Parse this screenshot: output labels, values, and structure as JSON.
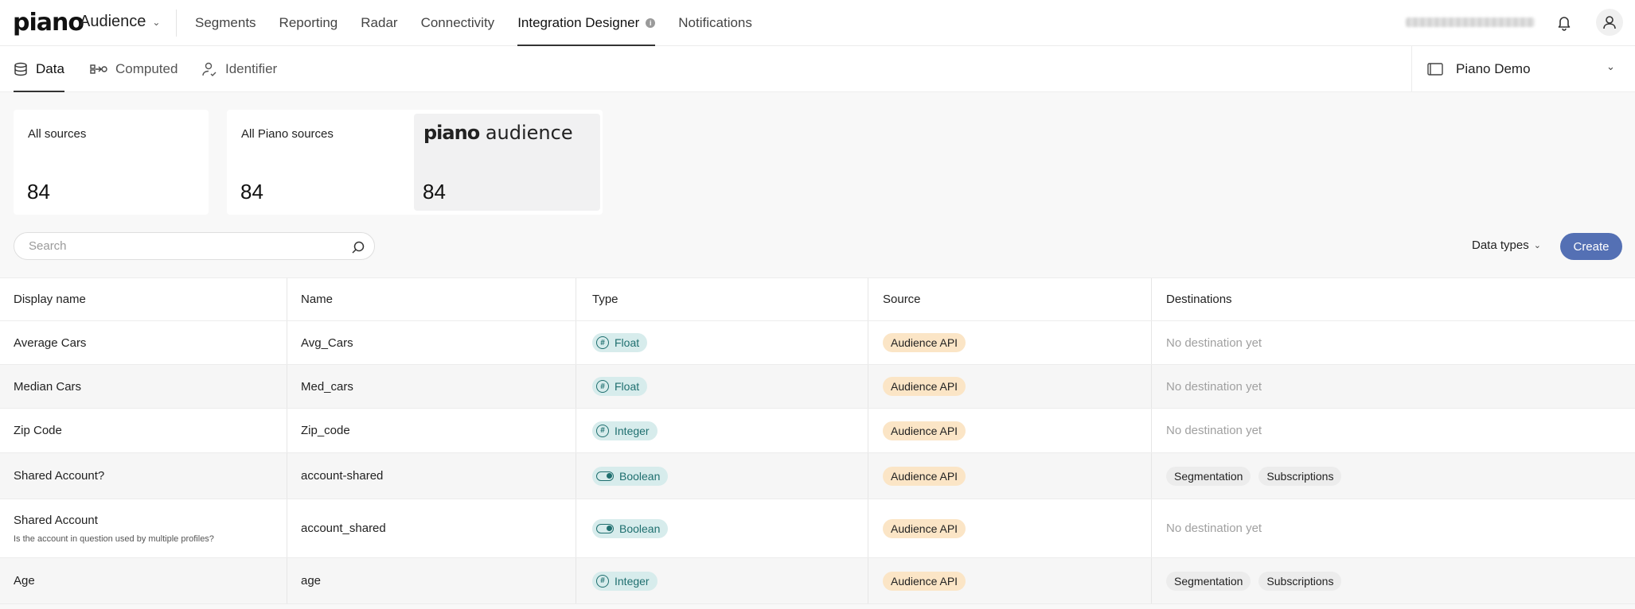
{
  "header": {
    "logo": "piano",
    "app_name": "Audience",
    "nav": [
      {
        "label": "Segments",
        "active": false
      },
      {
        "label": "Reporting",
        "active": false
      },
      {
        "label": "Radar",
        "active": false
      },
      {
        "label": "Connectivity",
        "active": false
      },
      {
        "label": "Integration Designer",
        "active": true
      },
      {
        "label": "Notifications",
        "active": false
      }
    ],
    "info_icon": "info-icon",
    "bell_icon": "bell-icon",
    "user_icon": "user-icon"
  },
  "subnav": {
    "tabs": [
      {
        "label": "Data",
        "icon": "database-icon",
        "active": true
      },
      {
        "label": "Computed",
        "icon": "computed-icon",
        "active": false
      },
      {
        "label": "Identifier",
        "icon": "identifier-icon",
        "active": false
      }
    ],
    "workspace": {
      "label": "Piano Demo",
      "icon": "workspace-icon"
    }
  },
  "cards": [
    {
      "label": "All sources",
      "value": "84"
    },
    {
      "label": "All Piano sources",
      "value": "84"
    },
    {
      "brand_bold": "piano",
      "brand_light": "audience",
      "value": "84",
      "selected": true
    }
  ],
  "toolbar": {
    "search_placeholder": "Search",
    "data_types_label": "Data types",
    "create_label": "Create"
  },
  "table": {
    "columns": [
      "Display name",
      "Name",
      "Type",
      "Source",
      "Destinations"
    ],
    "rows": [
      {
        "display_name": "Average Cars",
        "description": "",
        "name": "Avg_Cars",
        "type": "Float",
        "type_icon": "hash-icon",
        "source": "Audience API",
        "destinations": [],
        "no_destination": "No destination yet"
      },
      {
        "display_name": "Median Cars",
        "description": "",
        "name": "Med_cars",
        "type": "Float",
        "type_icon": "hash-icon",
        "source": "Audience API",
        "destinations": [],
        "no_destination": "No destination yet"
      },
      {
        "display_name": "Zip Code",
        "description": "",
        "name": "Zip_code",
        "type": "Integer",
        "type_icon": "hash-icon",
        "source": "Audience API",
        "destinations": [],
        "no_destination": "No destination yet"
      },
      {
        "display_name": "Shared Account?",
        "description": "",
        "name": "account-shared",
        "type": "Boolean",
        "type_icon": "toggle-icon",
        "source": "Audience API",
        "destinations": [
          "Segmentation",
          "Subscriptions"
        ],
        "no_destination": ""
      },
      {
        "display_name": "Shared Account",
        "description": "Is the account in question used by multiple profiles?",
        "name": "account_shared",
        "type": "Boolean",
        "type_icon": "toggle-icon",
        "source": "Audience API",
        "destinations": [],
        "no_destination": "No destination yet"
      },
      {
        "display_name": "Age",
        "description": "",
        "name": "age",
        "type": "Integer",
        "type_icon": "hash-icon",
        "source": "Audience API",
        "destinations": [
          "Segmentation",
          "Subscriptions"
        ],
        "no_destination": ""
      }
    ]
  }
}
